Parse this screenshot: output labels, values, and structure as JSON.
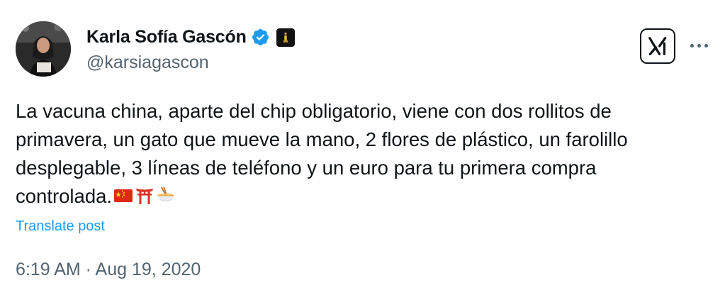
{
  "author": {
    "display_name": "Karla Sofía Gascón",
    "handle": "@karsiagascon",
    "verified_badge_color": "#1d9bf0",
    "affiliation_badge": "gold-award-badge"
  },
  "tweet": {
    "text_lines": [
      "La vacuna china, aparte del chip obligatorio, viene con dos rollitos de",
      "primavera, un gato que mueve la mano, 2 flores de plástico, un farolillo",
      "desplegable, 3 líneas de teléfono y un euro para tu primera compra",
      "controlada."
    ],
    "emojis": [
      "china-flag-emoji",
      "torii-gate-emoji",
      "noodle-bowl-emoji"
    ],
    "translate_label": "Translate post",
    "timestamp": "6:19 AM · Aug 19, 2020"
  },
  "colors": {
    "link": "#1d9bf0",
    "secondary_text": "#536471",
    "primary_text": "#0f1419"
  },
  "icons": {
    "x_logo": "x-logo-icon",
    "more": "more-options-icon"
  }
}
